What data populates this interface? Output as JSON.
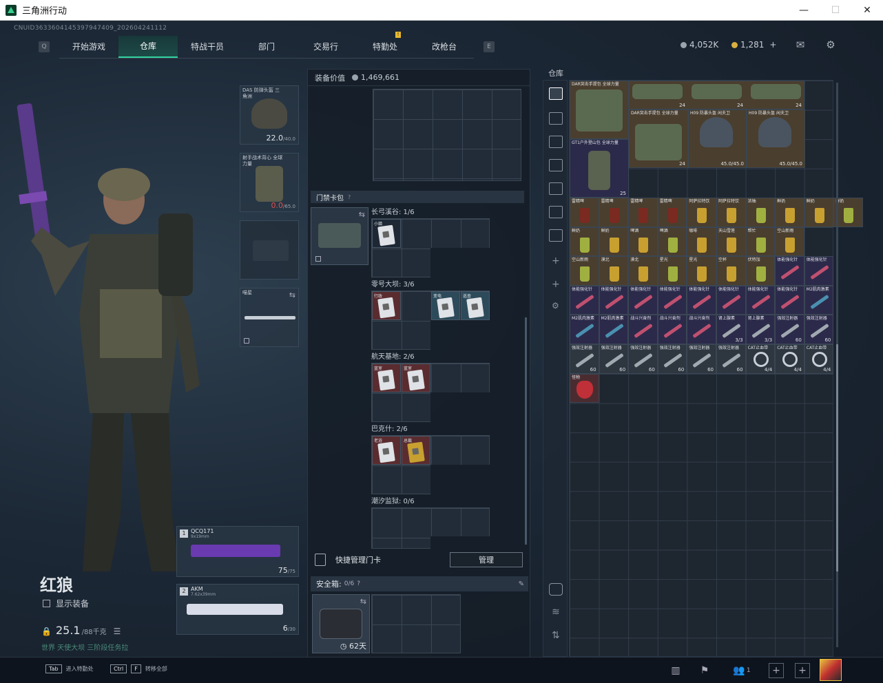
{
  "window": {
    "title": "三角洲行动",
    "minimize": "—",
    "maximize": "☐",
    "close": "✕"
  },
  "uid": "CNUID3633604145397947409_202604241112",
  "nav": {
    "tabs": [
      {
        "label": "开始游戏"
      },
      {
        "label": "仓库"
      },
      {
        "label": "特战干员"
      },
      {
        "label": "部门"
      },
      {
        "label": "交易行"
      },
      {
        "label": "特勤处"
      },
      {
        "label": "改枪台"
      }
    ],
    "alert_badge": "!"
  },
  "currency": {
    "coin_a": "4,052K",
    "coin_b": "1,281",
    "plus": "+"
  },
  "operator": {
    "name": "红狼",
    "show_equip": "显示装备",
    "weight": "25.1",
    "weight_max": "/88千克",
    "task_tip": "世界 天使大坝 三阶段任务拉"
  },
  "equip": {
    "helmet": {
      "label": "DAS 防弹头盔 三角洲",
      "dur": "22.0",
      "dur_max": "/40.0"
    },
    "armor": {
      "label": "射手战术背心 全球力量",
      "dur": "0.0",
      "dur_max": "/65.0"
    },
    "melee": {
      "label": "喵星"
    }
  },
  "weapons": [
    {
      "num": "1",
      "name": "QCQ171",
      "cal": "9x19mm",
      "ammo": "75",
      "ammo_max": "/75"
    },
    {
      "num": "2",
      "name": "AKM",
      "cal": "7.62x39mm",
      "ammo": "6",
      "ammo_max": "/30"
    }
  ],
  "mid": {
    "equip_value_label": "装备价值",
    "equip_value": "1,469,661",
    "keycard_header": "门禁卡包",
    "maps": [
      {
        "title": "长弓溪谷: 1/6"
      },
      {
        "title": "零号大坝: 3/6"
      },
      {
        "title": "航天基地: 2/6"
      },
      {
        "title": "巴克什: 2/6"
      },
      {
        "title": "潮汐监狱: 0/6"
      }
    ],
    "cards": {
      "c1": "小鎮",
      "c2": "行政",
      "c3": "变电",
      "c4": "巡查",
      "c5": "蓝室",
      "c6": "蓝室",
      "c7": "老浴",
      "c8": "总裁"
    },
    "quick_label": "快捷管理门卡",
    "manage_btn": "管理",
    "safebox_label": "安全箱:",
    "safebox_cap": "0/6",
    "safebox_timer": "62天",
    "help_mark": "?",
    "pin": "📌"
  },
  "store": {
    "title": "仓库",
    "items": {
      "bag1": "DAR突击手提包 全球力量",
      "bag2": "DAR突击手提包 全球力量",
      "bag3": "GT1户外登山包 全球力量",
      "helm1": "H09 防暴头盔 闲夫卫",
      "helm2": "H09 防暴头盔 闲夫卫",
      "cnt24": "24",
      "cnt25": "25",
      "helm_dur": "45.0/45.0",
      "drinks": [
        "雷精啤",
        "雷精啤",
        "雷精啤",
        "雷精啤",
        "阿萨拉特饮",
        "阿萨拉特饮",
        "浓柚",
        "鲜奶",
        "鲜奶",
        "鲜奶"
      ],
      "drinks2": [
        "鲜奶",
        "鲜奶",
        "啤酒",
        "啤酒",
        "咖啡",
        "天山雪莲",
        "帮忙",
        "空山新雨"
      ],
      "drinks3": [
        "空山新雨",
        "漠北",
        "漠北",
        "星光",
        "星光",
        "空杯",
        "伏特加",
        "体能强化针",
        "体能强化针"
      ],
      "syringes": [
        "体能强化针",
        "体能强化针",
        "体能强化针",
        "体能强化针",
        "体能强化针",
        "体能强化针",
        "体能强化针",
        "体能强化针",
        "M2肌肉激素"
      ],
      "syringes2": [
        "M2肌肉激素",
        "M2肌肉激素",
        "战斗兴奋剂",
        "战斗兴奋剂",
        "战斗兴奋剂",
        "肾上腺素",
        "肾上腺素",
        "强效注射器",
        "强效注射器"
      ],
      "meds": [
        "强效注射器",
        "强效注射器",
        "强效注射器",
        "强效注射器",
        "强效注射器",
        "强效注射器",
        "CAT止血带",
        "CAT止血带",
        "CAT止血带"
      ],
      "mask": "怪物",
      "c60": "60",
      "c33": "3/3",
      "c44": "4/4"
    }
  },
  "bottom": {
    "tab_key": "Tab",
    "tab_label": "进入特勤处",
    "ctrl_key": "Ctrl",
    "f_key": "F",
    "ctrl_label": "转移全部",
    "friends": "1",
    "alert": "!"
  }
}
